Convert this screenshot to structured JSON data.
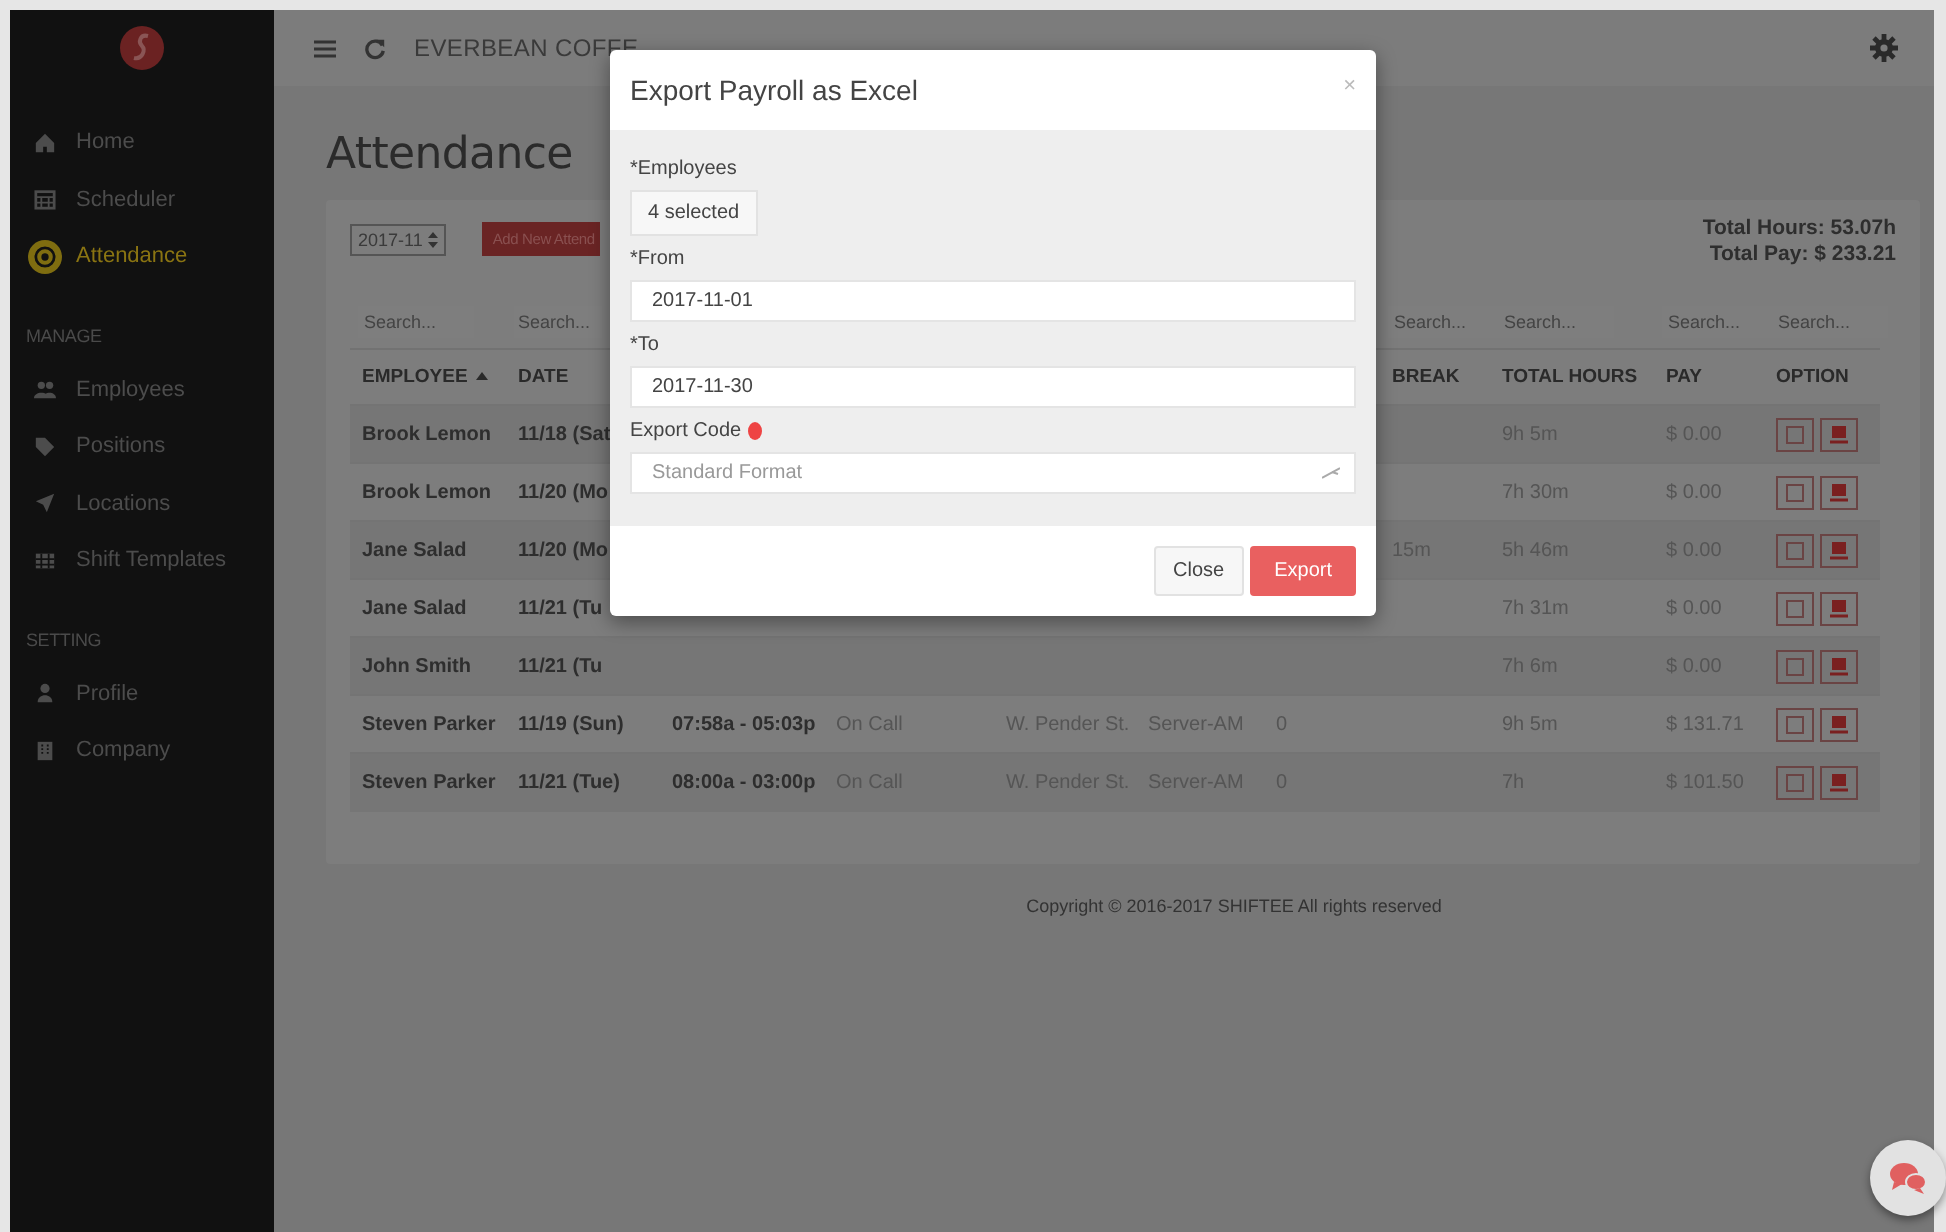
{
  "sidebar": {
    "groups": [
      {
        "items": [
          {
            "label": "Home",
            "selected": false
          },
          {
            "label": "Scheduler",
            "selected": false
          },
          {
            "label": "Attendance",
            "selected": true
          }
        ]
      },
      {
        "heading": "MANAGE",
        "items": [
          {
            "label": "Employees",
            "selected": false
          },
          {
            "label": "Positions",
            "selected": false
          },
          {
            "label": "Locations",
            "selected": false
          },
          {
            "label": "Shift Templates",
            "selected": false
          }
        ]
      },
      {
        "heading": "SETTING",
        "items": [
          {
            "label": "Profile",
            "selected": false
          },
          {
            "label": "Company",
            "selected": false
          }
        ]
      }
    ]
  },
  "topbar": {
    "company": "EVERBEAN COFFE"
  },
  "page": {
    "title": "Attendance",
    "month": "2017-11",
    "add_button": "Add New Attend",
    "totals": [
      "Total Hours: 53.07h",
      "Total Pay: $ 233.21"
    ]
  },
  "table": {
    "columns": [
      {
        "header": "EMPLOYEE",
        "placeholder": "Search...",
        "sorted": true
      },
      {
        "header": "DATE",
        "placeholder": "Search...",
        "sorted": false
      },
      {},
      {},
      {},
      {},
      {},
      {
        "header": "BREAK",
        "placeholder": "Search...",
        "sorted": false
      },
      {
        "header": "TOTAL HOURS",
        "placeholder": "Search...",
        "sorted": false
      },
      {
        "header": "PAY",
        "placeholder": "Search...",
        "sorted": false
      },
      {
        "header": "OPTION",
        "placeholder": "Search...",
        "sorted": false
      }
    ],
    "rows": [
      {
        "cells": [
          "Brook Lemon",
          "11/18 (Sat",
          null,
          null,
          null,
          null,
          null,
          null,
          "9h 5m",
          "$ 0.00"
        ]
      },
      {
        "cells": [
          "Brook Lemon",
          "11/20 (Mo",
          null,
          null,
          null,
          null,
          null,
          null,
          "7h 30m",
          "$ 0.00"
        ]
      },
      {
        "cells": [
          "Jane Salad",
          "11/20 (Mo",
          null,
          null,
          null,
          null,
          null,
          "15m",
          "5h 46m",
          "$ 0.00"
        ]
      },
      {
        "cells": [
          "Jane Salad",
          "11/21 (Tu",
          null,
          null,
          null,
          null,
          null,
          null,
          "7h 31m",
          "$ 0.00"
        ]
      },
      {
        "cells": [
          "John Smith",
          "11/21 (Tu",
          null,
          null,
          null,
          null,
          null,
          null,
          "7h 6m",
          "$ 0.00"
        ]
      },
      {
        "cells": [
          "Steven Parker",
          "11/19 (Sun)",
          "07:58a - 05:03p",
          "On Call",
          "W. Pender St.",
          "Server-AM",
          "0",
          null,
          "9h 5m",
          "$ 131.71"
        ]
      },
      {
        "cells": [
          "Steven Parker",
          "11/21 (Tue)",
          "08:00a - 03:00p",
          "On Call",
          "W. Pender St.",
          "Server-AM",
          "0",
          null,
          "7h",
          "$ 101.50"
        ]
      }
    ]
  },
  "footer": "Copyright © 2016-2017 SHIFTEE All rights reserved",
  "modal": {
    "title": "Export Payroll as Excel",
    "close": "×",
    "fields": [
      {
        "kind": "multiselect",
        "label": "*Employees",
        "value": "4 selected"
      },
      {
        "kind": "input",
        "label": "*From",
        "value": "2017-11-01"
      },
      {
        "kind": "input",
        "label": "*To",
        "value": "2017-11-30"
      },
      {
        "kind": "select",
        "label": "Export Code",
        "info": true,
        "placeholder": "Standard Format"
      }
    ],
    "buttons": [
      {
        "kind": "default",
        "label": "Close"
      },
      {
        "kind": "primary",
        "label": "Export"
      }
    ]
  }
}
